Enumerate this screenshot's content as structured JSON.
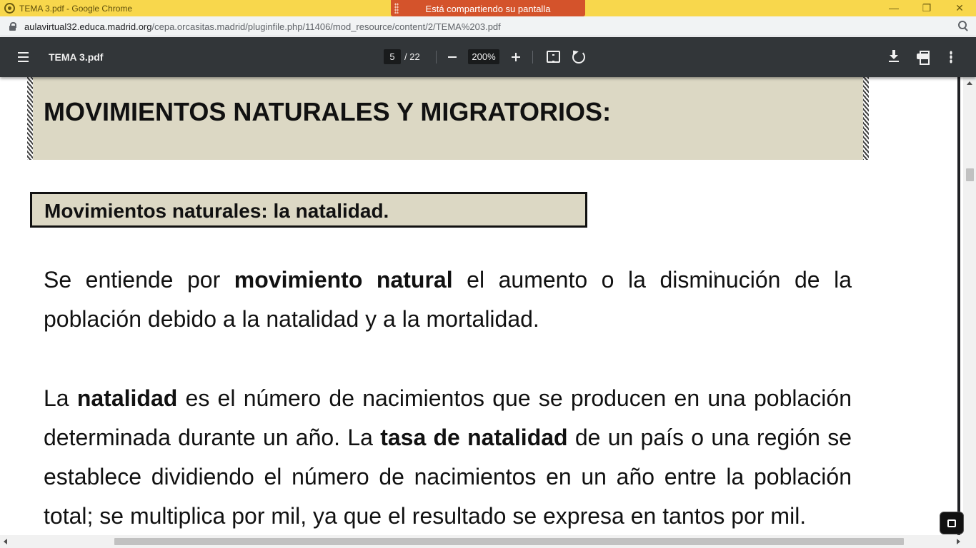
{
  "window": {
    "title": "TEMA 3.pdf - Google Chrome",
    "share_banner": "Está compartiendo su pantalla",
    "controls": {
      "minimize": "—",
      "restore": "❐",
      "close": "✕"
    }
  },
  "address_bar": {
    "host": "aulavirtual32.educa.madrid.org",
    "path": "/cepa.orcasitas.madrid/pluginfile.php/11406/mod_resource/content/2/TEMA%203.pdf"
  },
  "pdf_toolbar": {
    "title": "TEMA 3.pdf",
    "current_page": "5",
    "total_pages": "/ 22",
    "zoom": "200%"
  },
  "document": {
    "main_heading": "MOVIMIENTOS NATURALES Y MIGRATORIOS:",
    "sub_heading": "Movimientos naturales: la natalidad.",
    "para1": {
      "t1": "Se entiende por ",
      "b1": "movimiento natural",
      "t2": " el aumento o la disminución de la población debido a la natalidad y a la mortalidad."
    },
    "para2": {
      "t1": "La ",
      "b1": "natalidad",
      "t2": " es el número de nacimientos que se producen en una población determinada durante un año. La ",
      "b2": "tasa de natalidad",
      "t3": " de un país o una región se establece dividiendo el número de nacimientos en un año entre la población total; se multiplica por mil, ya que el resultado se expresa en tantos por mil."
    }
  },
  "colors": {
    "title_bar": "#f8d74c",
    "share_banner": "#d4532b",
    "toolbar": "#323639",
    "heading_fill": "#dcd8c4"
  },
  "icons": [
    "chrome-icon",
    "lock-icon",
    "zoom-icon",
    "menu-icon",
    "zoom-out-icon",
    "zoom-in-icon",
    "fit-page-icon",
    "rotate-icon",
    "download-icon",
    "print-icon",
    "more-icon",
    "exit-fullscreen-icon"
  ]
}
